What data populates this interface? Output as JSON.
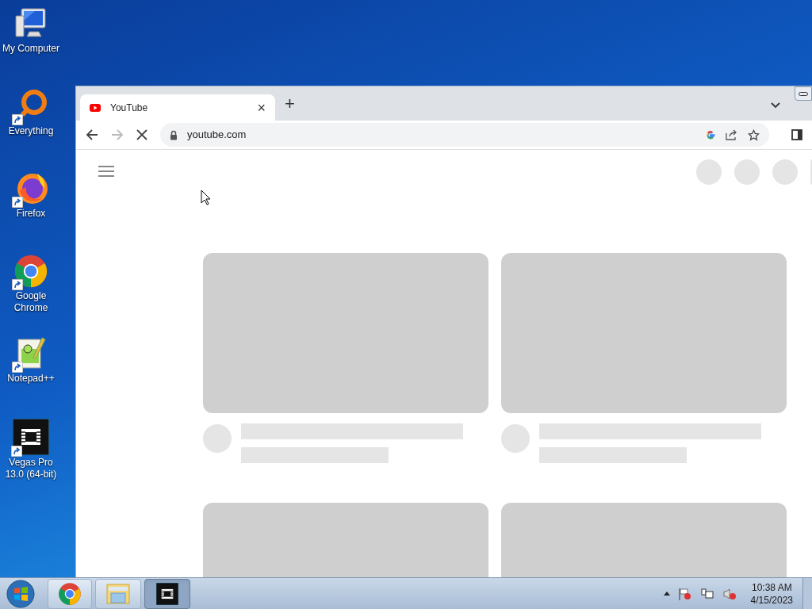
{
  "desktop_icons": [
    {
      "kind": "computer",
      "label": "My Computer",
      "shortcut": false
    },
    {
      "kind": "everything",
      "label": "Everything",
      "shortcut": true
    },
    {
      "kind": "firefox",
      "label": "Firefox",
      "shortcut": true
    },
    {
      "kind": "chrome",
      "label": "Google Chrome",
      "shortcut": true
    },
    {
      "kind": "notepad",
      "label": "Notepad++",
      "shortcut": true
    },
    {
      "kind": "vegas",
      "label": "Vegas Pro 13.0 (64-bit)",
      "shortcut": true
    }
  ],
  "browser": {
    "tab": {
      "title": "YouTube",
      "close": "×"
    },
    "new_tab": "+",
    "url": "youtube.com",
    "loading": true
  },
  "taskbar": {
    "items": [
      {
        "kind": "chrome",
        "selected": false
      },
      {
        "kind": "explorer",
        "selected": false
      },
      {
        "kind": "vegas",
        "selected": true
      }
    ],
    "clock": {
      "time": "10:38 AM",
      "date": "4/15/2023"
    }
  }
}
